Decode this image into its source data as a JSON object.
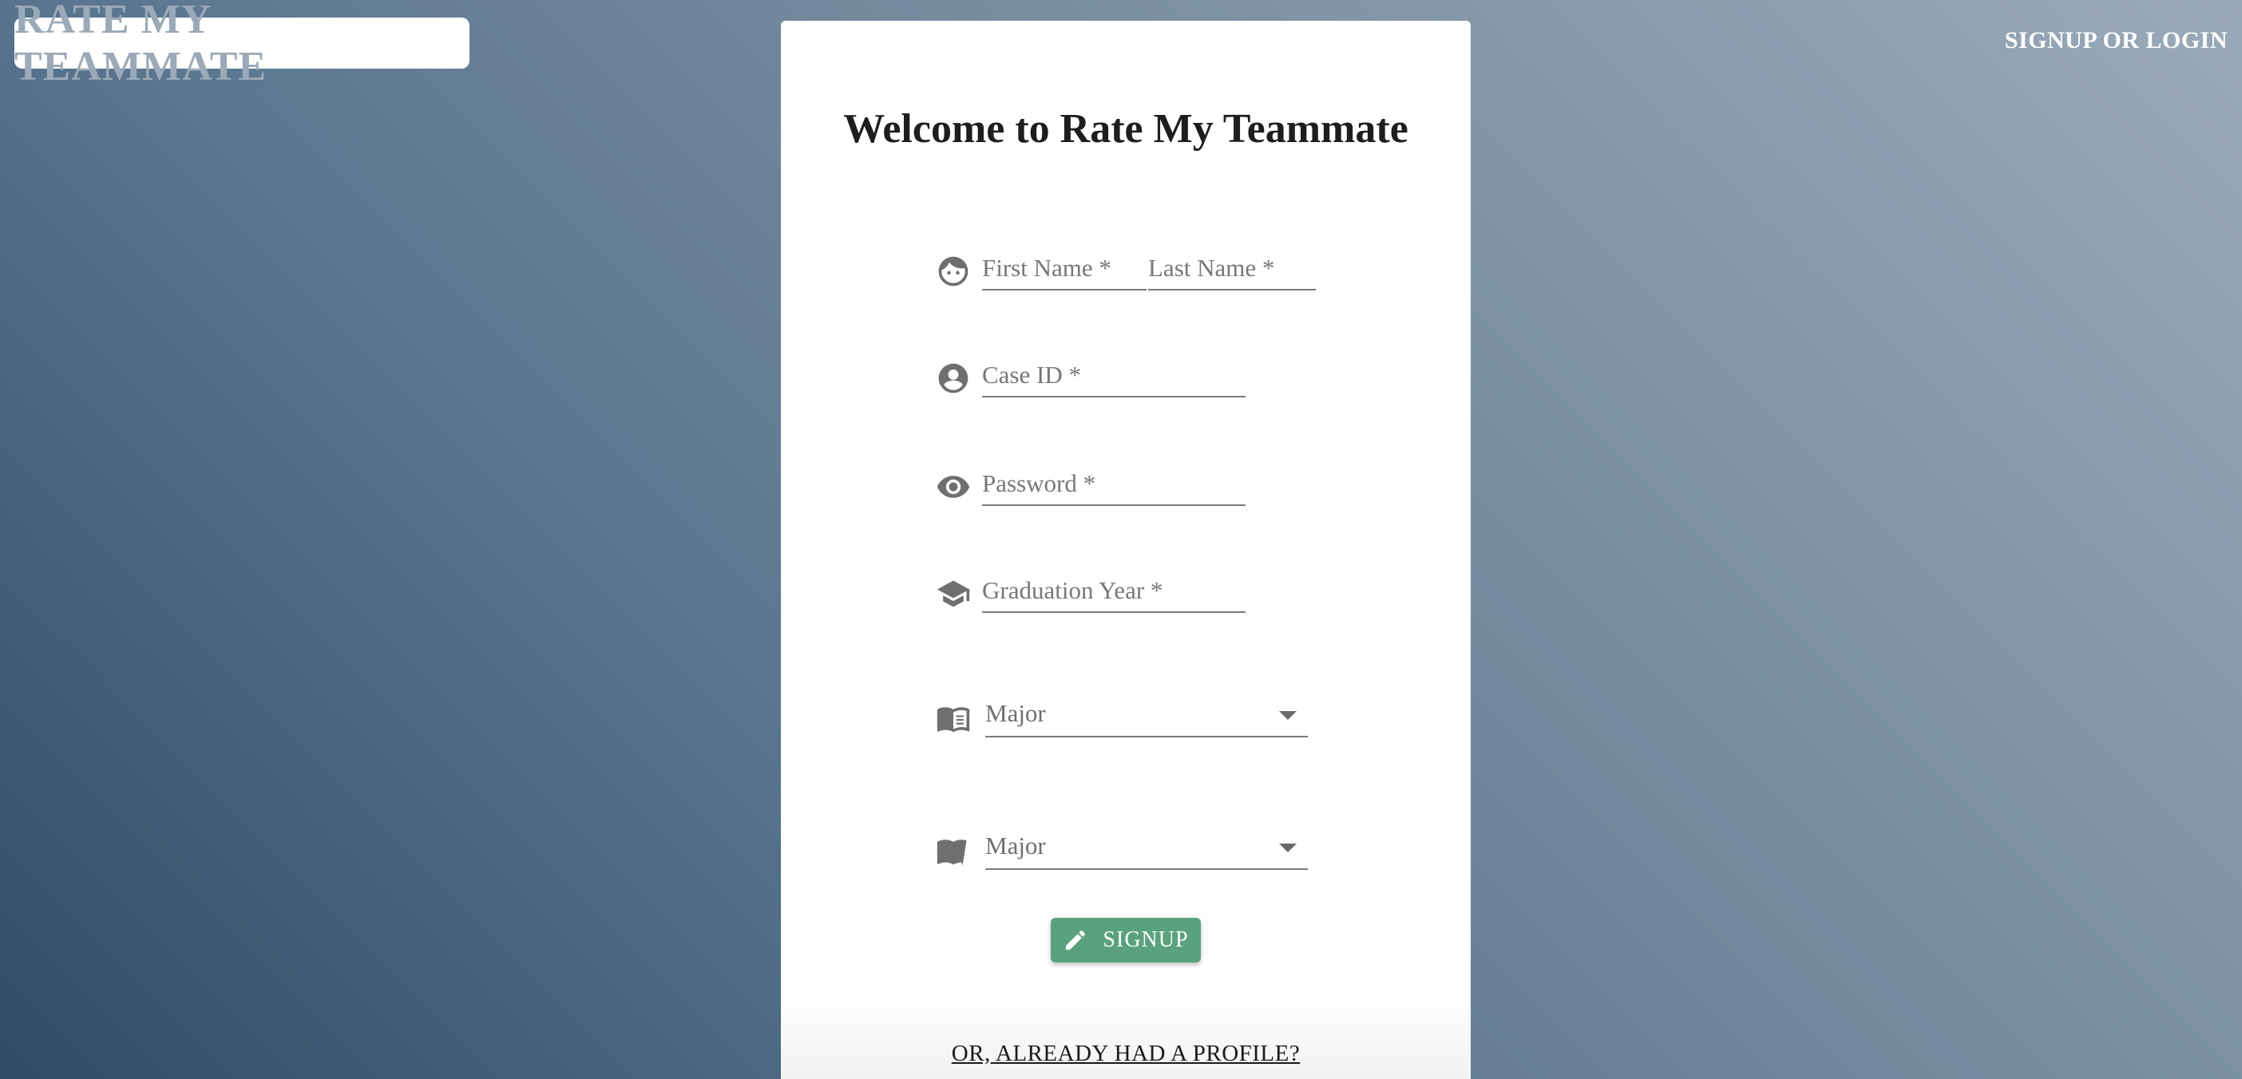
{
  "header": {
    "logo_text": "RATE MY TEAMMATE",
    "nav_link": "SIGNUP OR LOGIN"
  },
  "form": {
    "title": "Welcome to Rate My Teammate",
    "first_name_placeholder": "First Name *",
    "last_name_placeholder": "Last Name *",
    "case_id_placeholder": "Case ID *",
    "password_placeholder": "Password *",
    "graduation_year_placeholder": "Graduation Year *",
    "major_1_label": "Major",
    "major_2_label": "Major",
    "signup_label": "SIGNUP",
    "already_link": "OR, ALREADY HAD A PROFILE?"
  },
  "icons": {
    "name": "face-icon",
    "case_id": "account-circle-icon",
    "password": "eye-icon",
    "graduation": "school-icon",
    "major": "book-icon",
    "signup": "pencil-icon"
  },
  "colors": {
    "accent": "#5aa27e",
    "logo_text": "#9aaab9",
    "background_light": "#9aaab8",
    "background_dark": "#2f4d66"
  }
}
